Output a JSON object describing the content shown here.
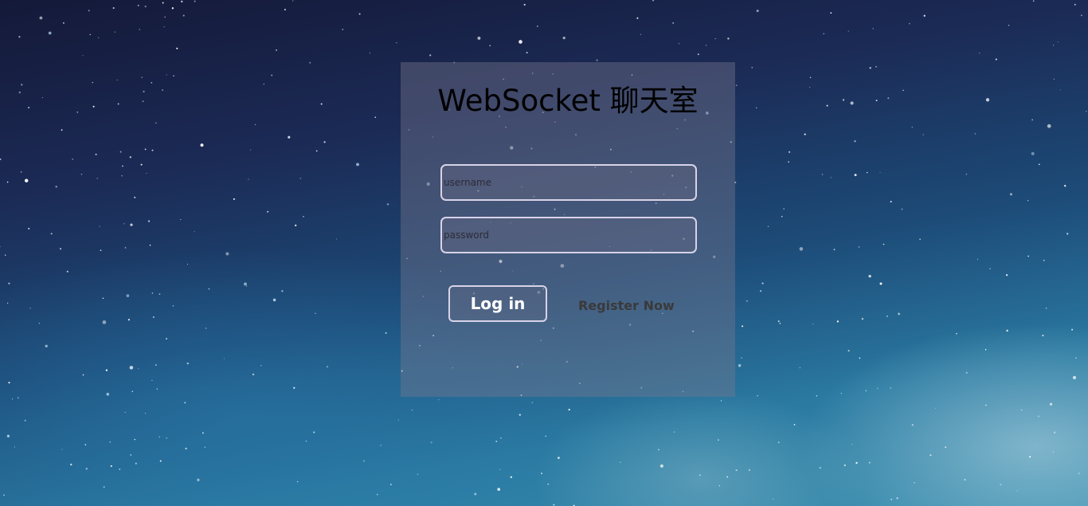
{
  "app": {
    "title": "WebSocket 聊天室"
  },
  "form": {
    "username": {
      "placeholder": "username",
      "value": ""
    },
    "password": {
      "placeholder": "password",
      "value": ""
    },
    "login_label": "Log in",
    "register_label": "Register Now"
  },
  "colors": {
    "background_top": "#141938",
    "background_bottom": "#3b8fb0",
    "panel": "#78788c",
    "field_border": "#d8d3e8",
    "title_text": "#000000",
    "button_text": "#ffffff",
    "register_text": "#3a3a3a"
  }
}
